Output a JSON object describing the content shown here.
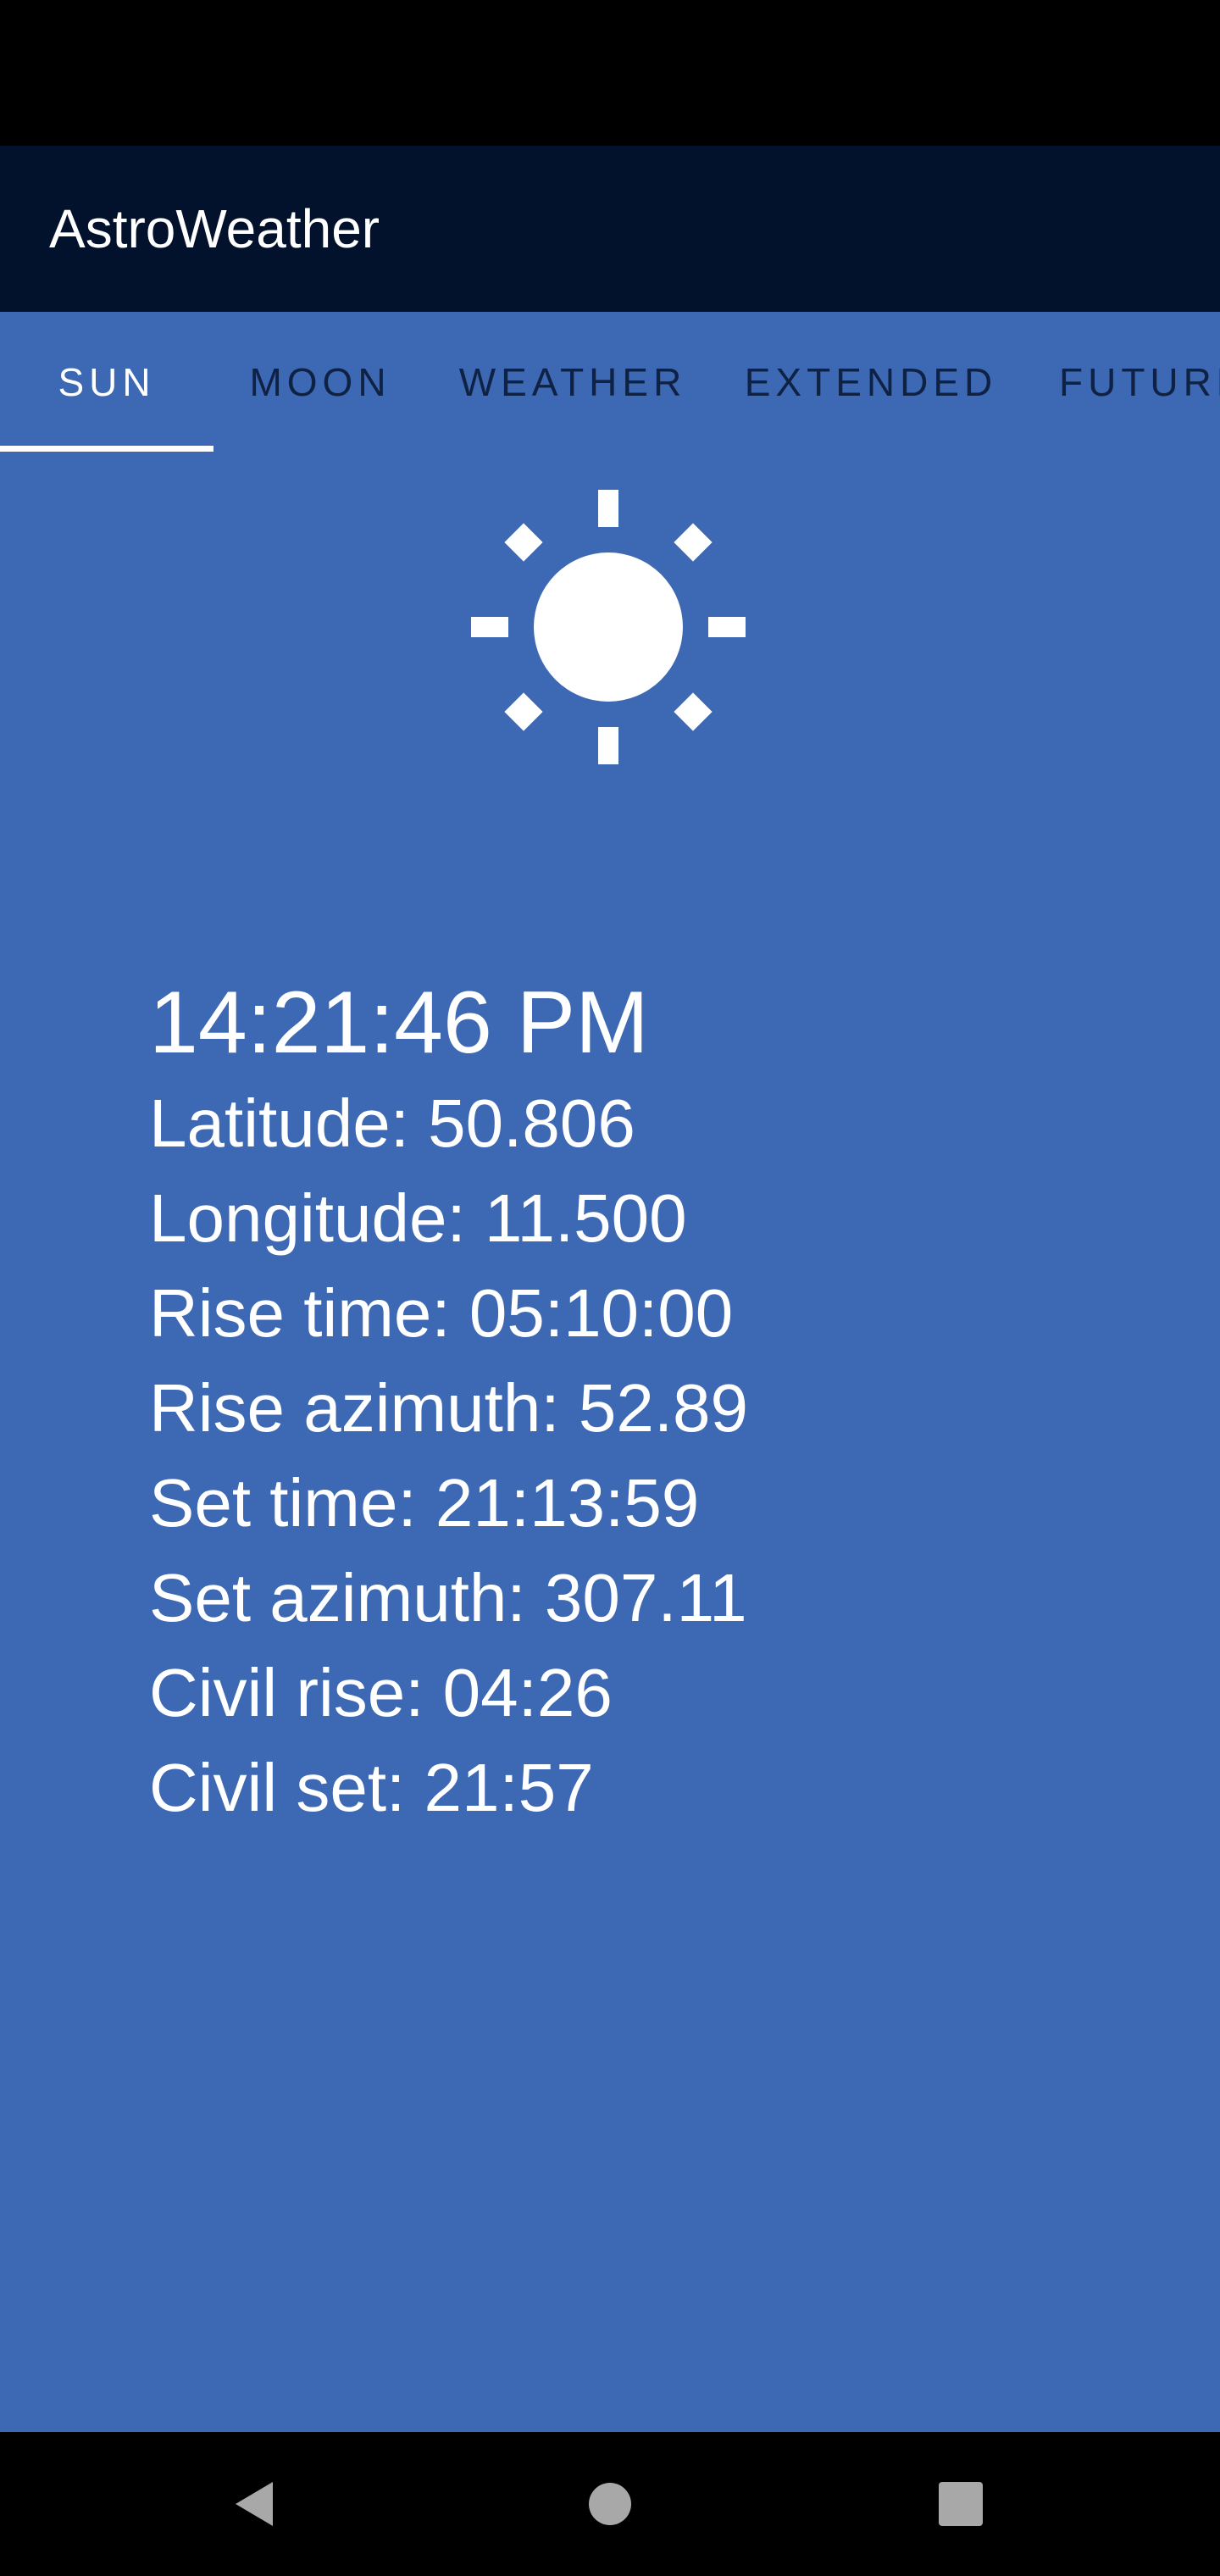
{
  "app": {
    "title": "AstroWeather"
  },
  "tabs": [
    {
      "label": "SUN",
      "active": true
    },
    {
      "label": "MOON",
      "active": false
    },
    {
      "label": "WEATHER",
      "active": false
    },
    {
      "label": "EXTENDED",
      "active": false
    },
    {
      "label": "FUTURE",
      "active": false
    }
  ],
  "sun_panel": {
    "icon": "sun-icon",
    "time": "14:21:46 PM",
    "latitude": "Latitude: 50.806",
    "longitude": "Longitude: 11.500",
    "rise_time": "Rise time: 05:10:00",
    "rise_azimuth": "Rise azimuth: 52.89",
    "set_time": "Set time: 21:13:59",
    "set_azimuth": "Set azimuth: 307.11",
    "civil_rise": "Civil rise: 04:26",
    "civil_set": "Civil set: 21:57"
  },
  "colors": {
    "app_bar": "#02112c",
    "background": "#3d68b3",
    "active_tab": "#ffffff",
    "inactive_tab": "#0f2244"
  },
  "nav": {
    "back_icon": "back-triangle-icon",
    "home_icon": "home-circle-icon",
    "recents_icon": "recents-square-icon"
  }
}
